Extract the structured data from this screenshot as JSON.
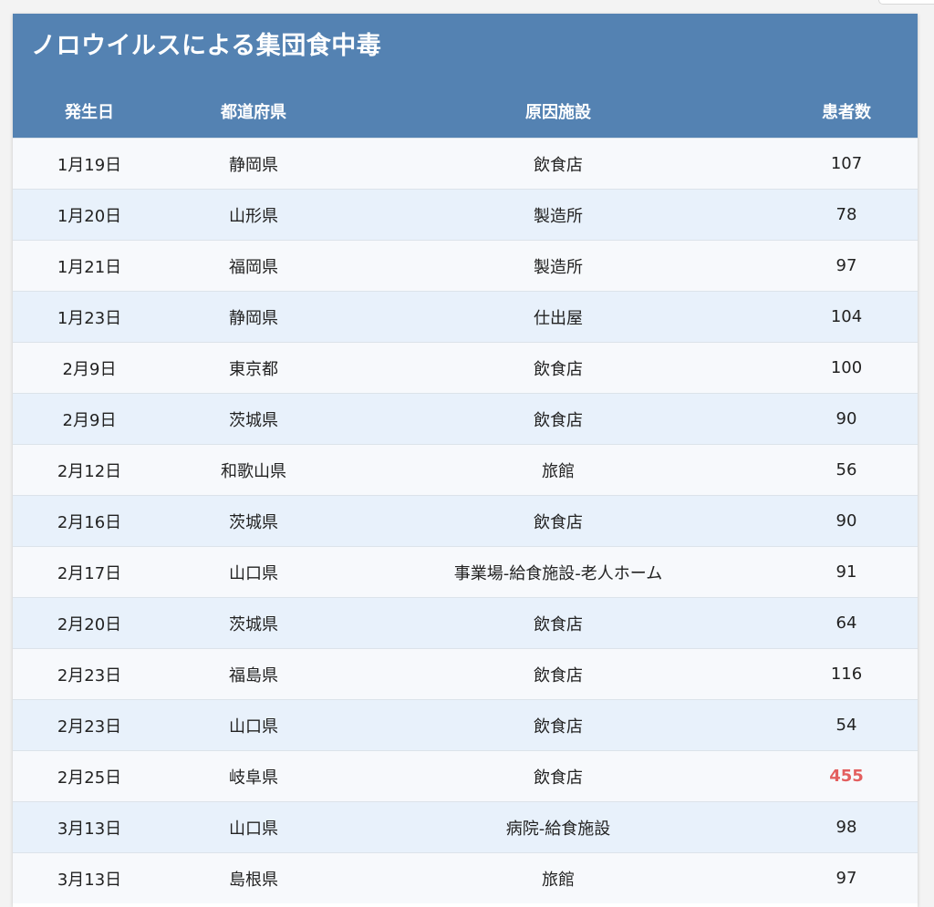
{
  "title": "ノロウイルスによる集団食中毒",
  "columns": {
    "date": "発生日",
    "prefecture": "都道府県",
    "facility": "原因施設",
    "patients": "患者数"
  },
  "rows": [
    {
      "date": "1月19日",
      "prefecture": "静岡県",
      "facility": "飲食店",
      "patients": "107"
    },
    {
      "date": "1月20日",
      "prefecture": "山形県",
      "facility": "製造所",
      "patients": "78"
    },
    {
      "date": "1月21日",
      "prefecture": "福岡県",
      "facility": "製造所",
      "patients": "97"
    },
    {
      "date": "1月23日",
      "prefecture": "静岡県",
      "facility": "仕出屋",
      "patients": "104"
    },
    {
      "date": "2月9日",
      "prefecture": "東京都",
      "facility": "飲食店",
      "patients": "100"
    },
    {
      "date": "2月9日",
      "prefecture": "茨城県",
      "facility": "飲食店",
      "patients": "90"
    },
    {
      "date": "2月12日",
      "prefecture": "和歌山県",
      "facility": "旅館",
      "patients": "56"
    },
    {
      "date": "2月16日",
      "prefecture": "茨城県",
      "facility": "飲食店",
      "patients": "90"
    },
    {
      "date": "2月17日",
      "prefecture": "山口県",
      "facility": "事業場-給食施設-老人ホーム",
      "patients": "91"
    },
    {
      "date": "2月20日",
      "prefecture": "茨城県",
      "facility": "飲食店",
      "patients": "64"
    },
    {
      "date": "2月23日",
      "prefecture": "福島県",
      "facility": "飲食店",
      "patients": "116"
    },
    {
      "date": "2月23日",
      "prefecture": "山口県",
      "facility": "飲食店",
      "patients": "54"
    },
    {
      "date": "2月25日",
      "prefecture": "岐阜県",
      "facility": "飲食店",
      "patients": "455",
      "highlight": true
    },
    {
      "date": "3月13日",
      "prefecture": "山口県",
      "facility": "病院-給食施設",
      "patients": "98"
    },
    {
      "date": "3月13日",
      "prefecture": "島根県",
      "facility": "旅館",
      "patients": "97"
    }
  ],
  "colors": {
    "header_bg": "#5482b2",
    "row_odd": "#f7f9fc",
    "row_even": "#e8f1fb",
    "highlight": "#e35f5f"
  }
}
